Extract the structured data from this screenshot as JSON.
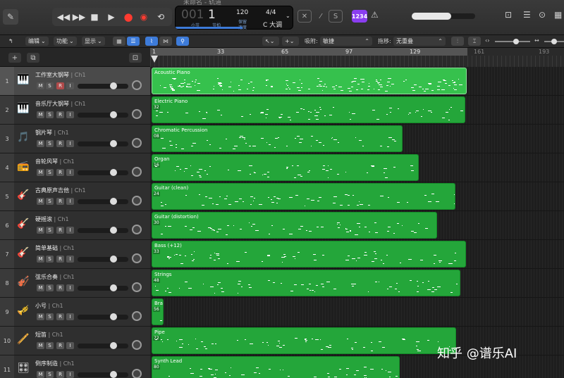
{
  "window": {
    "title": "未命名 - 轨道"
  },
  "transport": {
    "buttons": [
      "rewind",
      "fast-forward",
      "stop",
      "play",
      "record",
      "capture-record",
      "cycle"
    ],
    "lcd": {
      "bar": "001",
      "beat": "1",
      "bar_label": "小节",
      "beat_label": "节拍",
      "tempo": "120",
      "tempo_label": "保留",
      "tempo_sub": "速度",
      "signature": "4/4",
      "key": "C 大调"
    }
  },
  "toolbar_right": {
    "count_in": "1234"
  },
  "toolbar2": {
    "menus": [
      "编辑",
      "功能",
      "显示"
    ],
    "snap_label": "吸附:",
    "snap_value": "敏捷",
    "drag_label": "拖移:",
    "drag_value": "无重叠"
  },
  "ruler": {
    "marks": [
      "1",
      "33",
      "65",
      "97",
      "129",
      "161",
      "193"
    ]
  },
  "tracks": [
    {
      "num": "1",
      "name": "工作室大钢琴",
      "ch": "Ch1",
      "region": "Acoustic Piano",
      "sub": "",
      "selected": true
    },
    {
      "num": "2",
      "name": "音乐厅大钢琴",
      "ch": "Ch1",
      "region": "Electric Piano",
      "sub": "32"
    },
    {
      "num": "3",
      "name": "钢片琴",
      "ch": "Ch1",
      "region": "Chromatic Percussion",
      "sub": "08"
    },
    {
      "num": "4",
      "name": "音轮风琴",
      "ch": "Ch1",
      "region": "Organ",
      "sub": "16"
    },
    {
      "num": "5",
      "name": "古典原声吉他",
      "ch": "Ch1",
      "region": "Guitar (clean)",
      "sub": "24"
    },
    {
      "num": "6",
      "name": "硬摇滚",
      "ch": "Ch1",
      "region": "Guitar (distortion)",
      "sub": "30"
    },
    {
      "num": "7",
      "name": "简单基础",
      "ch": "Ch1",
      "region": "Bass (+12)",
      "sub": "33"
    },
    {
      "num": "8",
      "name": "弦乐合奏",
      "ch": "Ch1",
      "region": "Strings",
      "sub": "48"
    },
    {
      "num": "9",
      "name": "小号",
      "ch": "Ch1",
      "region": "Bra",
      "sub": "56"
    },
    {
      "num": "10",
      "name": "短笛",
      "ch": "Ch1",
      "region": "Pipe",
      "sub": "72"
    },
    {
      "num": "11",
      "name": "倒序制造",
      "ch": "Ch1",
      "region": "Synth Lead",
      "sub": "80"
    }
  ],
  "track_buttons": {
    "m": "M",
    "s": "S",
    "r": "R",
    "i": "I"
  },
  "watermark": "知乎 @谱乐AI"
}
